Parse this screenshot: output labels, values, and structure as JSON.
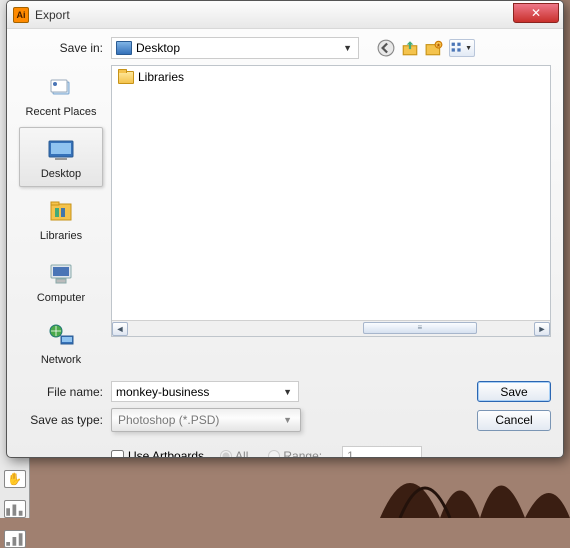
{
  "window": {
    "title": "Export"
  },
  "save_in": {
    "label": "Save in:",
    "value": "Desktop"
  },
  "toolbar_icons": {
    "back": "back-icon",
    "up": "up-one-level-icon",
    "new_folder": "new-folder-icon",
    "views": "views-icon"
  },
  "places": [
    {
      "id": "recent-places",
      "label": "Recent Places"
    },
    {
      "id": "desktop",
      "label": "Desktop",
      "selected": true
    },
    {
      "id": "libraries",
      "label": "Libraries"
    },
    {
      "id": "computer",
      "label": "Computer"
    },
    {
      "id": "network",
      "label": "Network"
    }
  ],
  "file_list": [
    {
      "name": "Libraries",
      "type": "folder"
    }
  ],
  "file_name": {
    "label": "File name:",
    "value": "monkey-business"
  },
  "save_as_type": {
    "label": "Save as type:",
    "value": "Photoshop (*.PSD)"
  },
  "buttons": {
    "save": "Save",
    "cancel": "Cancel"
  },
  "artboards": {
    "use_label": "Use Artboards",
    "all_label": "All",
    "range_label": "Range:",
    "range_value": "1"
  },
  "bg_tools": [
    "hand-tool",
    "chart-tool-1",
    "chart-tool-2",
    "slice-tool"
  ]
}
